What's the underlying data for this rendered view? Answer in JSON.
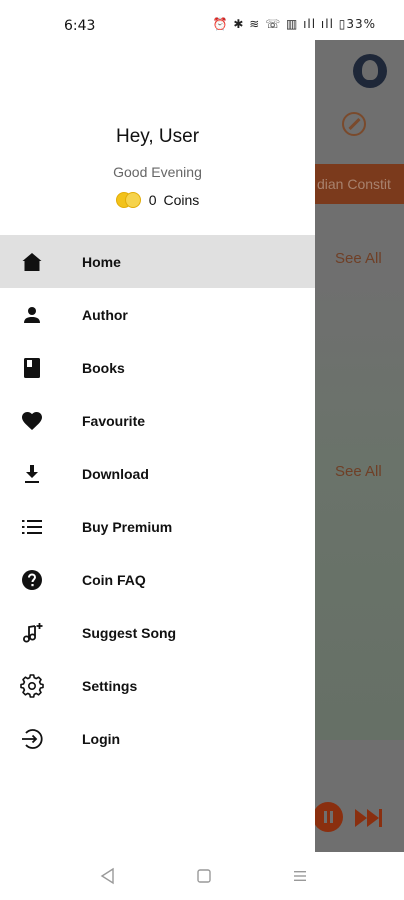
{
  "status_bar": {
    "time": "6:43",
    "icons": "⏰ ✱ ≋ ☏ ▥ ıll ıll ▯33%"
  },
  "drawer": {
    "greeting": "Hey, User",
    "subtitle": "Good Evening",
    "coins": {
      "count": "0",
      "label": "Coins"
    },
    "menu": [
      {
        "label": "Home",
        "icon": "home-icon",
        "active": true
      },
      {
        "label": "Author",
        "icon": "person-icon",
        "active": false
      },
      {
        "label": "Books",
        "icon": "book-icon",
        "active": false
      },
      {
        "label": "Favourite",
        "icon": "heart-icon",
        "active": false
      },
      {
        "label": "Download",
        "icon": "download-icon",
        "active": false
      },
      {
        "label": "Buy Premium",
        "icon": "list-icon",
        "active": false
      },
      {
        "label": "Coin FAQ",
        "icon": "help-circle-icon",
        "active": false
      },
      {
        "label": "Suggest Song",
        "icon": "music-note-plus-icon",
        "active": false
      },
      {
        "label": "Settings",
        "icon": "gear-icon",
        "active": false
      },
      {
        "label": "Login",
        "icon": "login-icon",
        "active": false
      }
    ]
  },
  "background": {
    "banner_text": "dian Constit",
    "see_all_1": "See All",
    "see_all_2": "See All"
  },
  "colors": {
    "accent": "#e0501e",
    "active_item_bg": "#e0e0e0",
    "coin": "#f2c21a"
  }
}
